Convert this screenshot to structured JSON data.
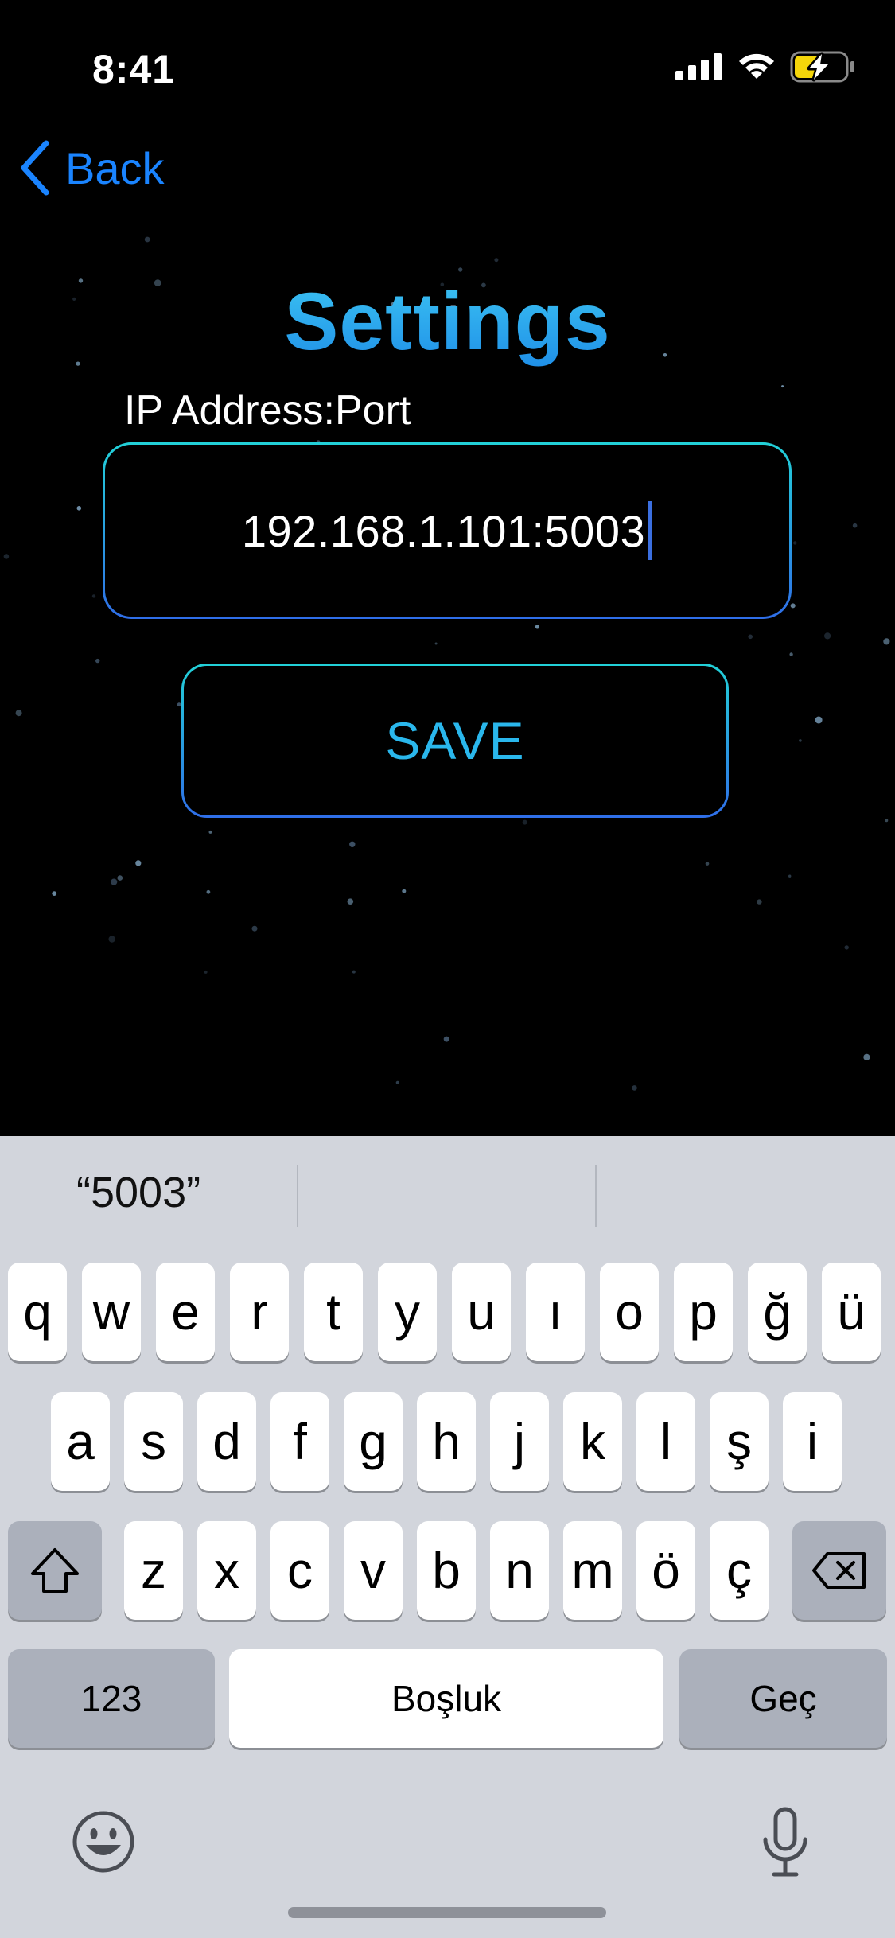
{
  "status_bar": {
    "time": "8:41"
  },
  "nav": {
    "back_label": "Back"
  },
  "settings": {
    "title": "Settings",
    "field_label": "IP Address:Port",
    "ip_value": "192.168.1.101:5003",
    "save_label": "SAVE"
  },
  "keyboard": {
    "suggestions": [
      "“5003”",
      "",
      ""
    ],
    "row1": [
      "q",
      "w",
      "e",
      "r",
      "t",
      "y",
      "u",
      "ı",
      "o",
      "p",
      "ğ",
      "ü"
    ],
    "row2": [
      "a",
      "s",
      "d",
      "f",
      "g",
      "h",
      "j",
      "k",
      "l",
      "ş",
      "i"
    ],
    "row3": [
      "z",
      "x",
      "c",
      "v",
      "b",
      "n",
      "m",
      "ö",
      "ç"
    ],
    "numbers_label": "123",
    "space_label": "Boşluk",
    "return_label": "Geç"
  },
  "colors": {
    "accent": "#1a84ff",
    "title_gradient": [
      "#3cc4f2",
      "#1f8fe8"
    ],
    "border_gradient": [
      "#22d1d8",
      "#2f6ee8"
    ]
  }
}
